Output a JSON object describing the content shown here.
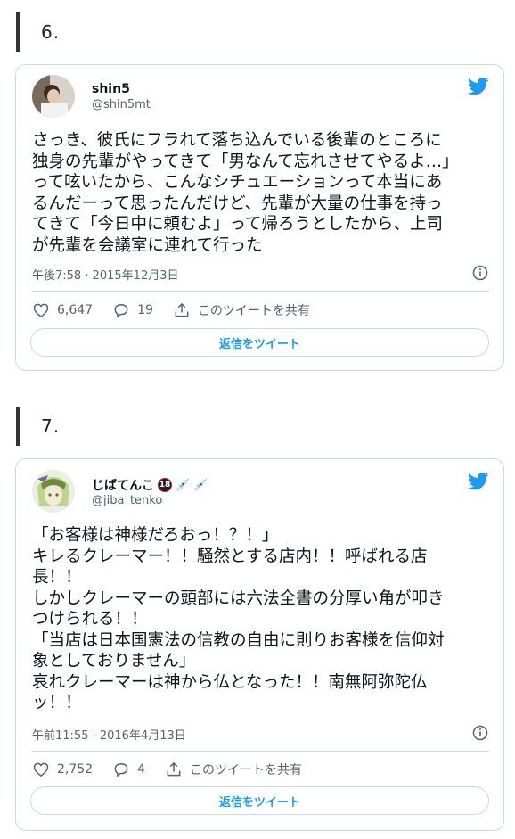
{
  "sections": [
    {
      "number": "6.",
      "tweet": {
        "display_name": "shin5",
        "handle": "@shin5mt",
        "text": "さっき、彼氏にフラれて落ち込んでいる後輩のところに\n独身の先輩がやってきて「男なんて忘れさせてやるよ…」\nって呟いたから、こんなシチュエーションって本当にあ\nるんだーって思ったんだけど、先輩が大量の仕事を持っ\nてきて「今日中に頼むよ」って帰ろうとしたから、上司\nが先輩を会議室に連れて行った",
        "timestamp": "午後7:58 · 2015年12月3日",
        "likes": "6,647",
        "replies": "19",
        "share_label": "このツイートを共有",
        "reply_button": "返信をツイート"
      }
    },
    {
      "number": "7.",
      "tweet": {
        "display_name": "じばてんこ",
        "badge": "18",
        "handle": "@jiba_tenko",
        "text": "「お客様は神様だろおっ！？！」\nキレるクレーマー！！騒然とする店内！！呼ばれる店\n長！！\nしかしクレーマーの頭部には六法全書の分厚い角が叩き\nつけられる！！\n「当店は日本国憲法の信教の自由に則りお客様を信仰対\n象としておりません」\n哀れクレーマーは神から仏となった！！南無阿弥陀仏\nッ！！",
        "timestamp": "午前11:55 · 2016年4月13日",
        "likes": "2,752",
        "replies": "4",
        "share_label": "このツイートを共有",
        "reply_button": "返信をツイート"
      }
    }
  ],
  "colors": {
    "twitter_blue": "#1d9bf0",
    "border": "#cfd9de",
    "muted": "#536471"
  },
  "icons": [
    "twitter-bird-icon",
    "info-icon",
    "heart-icon",
    "reply-icon",
    "share-icon",
    "syringe-icon"
  ]
}
